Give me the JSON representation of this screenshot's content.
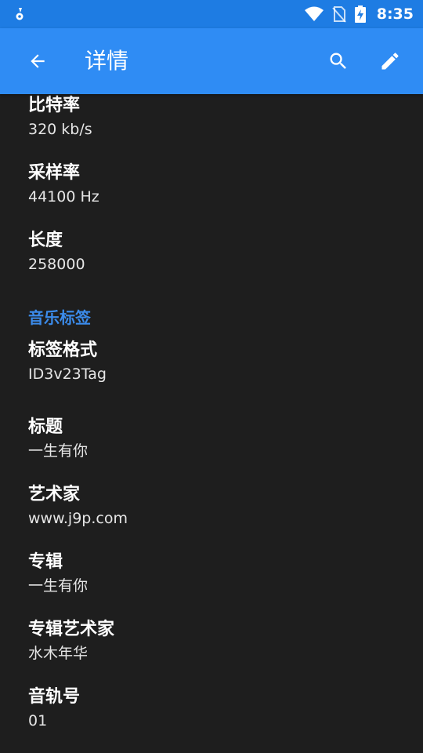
{
  "status_bar": {
    "time": "8:35"
  },
  "app_bar": {
    "title": "详情",
    "back_icon": "arrow-back-icon",
    "search_icon": "search-icon",
    "edit_icon": "pencil-icon"
  },
  "colors": {
    "accent": "#2f8cf4",
    "status_bar": "#1e7ce3",
    "background": "#1e1e1e",
    "section": "#3b8bea"
  },
  "audio_info": [
    {
      "label": "比特率",
      "value": "320 kb/s"
    },
    {
      "label": "采样率",
      "value": "44100 Hz"
    },
    {
      "label": "长度",
      "value": "258000"
    }
  ],
  "tags_section": {
    "header": "音乐标签",
    "items": [
      {
        "label": "标签格式",
        "value": "ID3v23Tag"
      },
      {
        "label": "标题",
        "value": "一生有你"
      },
      {
        "label": "艺术家",
        "value": "www.j9p.com"
      },
      {
        "label": "专辑",
        "value": "一生有你"
      },
      {
        "label": "专辑艺术家",
        "value": "水木年华"
      },
      {
        "label": "音轨号",
        "value": "01"
      }
    ]
  }
}
